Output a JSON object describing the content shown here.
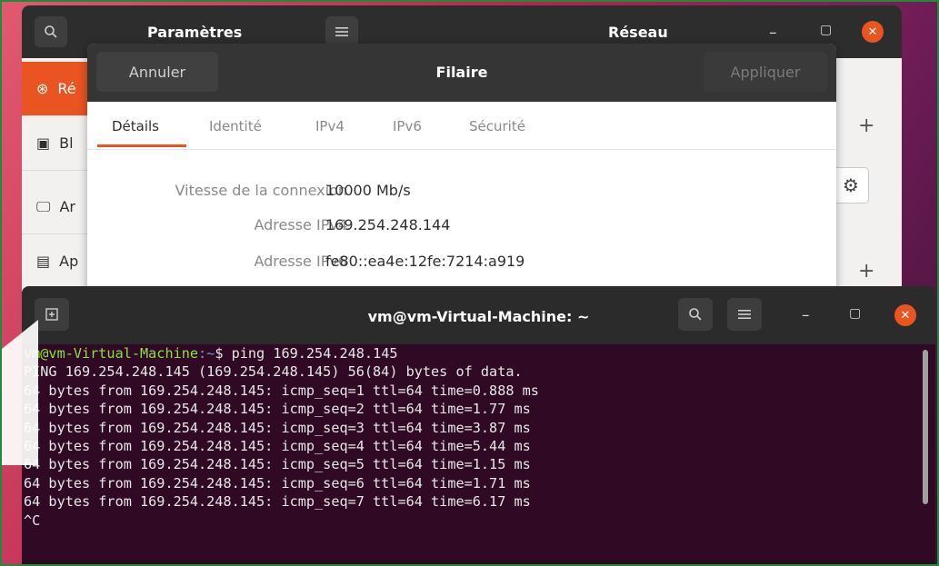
{
  "settings": {
    "title": "Paramètres",
    "page_title": "Réseau",
    "sidebar": [
      {
        "label": "Ré",
        "icon": "network-icon"
      },
      {
        "label": "Bl",
        "icon": "bluetooth-icon"
      },
      {
        "label": "Ar",
        "icon": "display-icon"
      },
      {
        "label": "Ap",
        "icon": "apps-icon"
      }
    ]
  },
  "dialog": {
    "title": "Filaire",
    "cancel_label": "Annuler",
    "apply_label": "Appliquer",
    "tabs": [
      "Détails",
      "Identité",
      "IPv4",
      "IPv6",
      "Sécurité"
    ],
    "details": [
      {
        "label": "Vitesse de la connexion",
        "value": "10000 Mb/s"
      },
      {
        "label": "Adresse IPv4",
        "value": "169.254.248.144"
      },
      {
        "label": "Adresse IPv6",
        "value": "fe80::ea4e:12fe:7214:a919"
      }
    ]
  },
  "terminal": {
    "title": "vm@vm-Virtual-Machine: ~",
    "prompt_user": "vm@vm-Virtual-Machine",
    "prompt_path": ":~",
    "prompt_symbol": "$ ",
    "command": "ping 169.254.248.145",
    "output": [
      "PING 169.254.248.145 (169.254.248.145) 56(84) bytes of data.",
      "64 bytes from 169.254.248.145: icmp_seq=1 ttl=64 time=0.888 ms",
      "64 bytes from 169.254.248.145: icmp_seq=2 ttl=64 time=1.77 ms",
      "64 bytes from 169.254.248.145: icmp_seq=3 ttl=64 time=3.87 ms",
      "64 bytes from 169.254.248.145: icmp_seq=4 ttl=64 time=5.44 ms",
      "64 bytes from 169.254.248.145: icmp_seq=5 ttl=64 time=1.15 ms",
      "64 bytes from 169.254.248.145: icmp_seq=6 ttl=64 time=1.71 ms",
      "64 bytes from 169.254.248.145: icmp_seq=7 ttl=64 time=6.17 ms",
      "^C"
    ]
  },
  "colors": {
    "accent": "#e95420",
    "terminal_bg": "#300a24",
    "prompt_user": "#8ae234",
    "prompt_path": "#729fcf"
  }
}
